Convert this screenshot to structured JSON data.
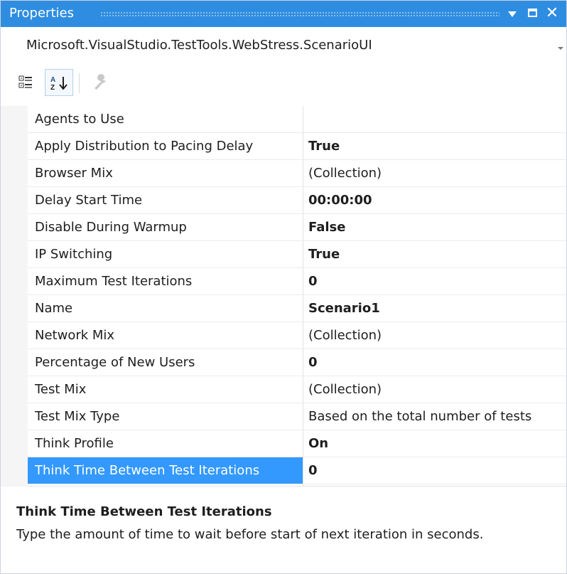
{
  "window": {
    "title": "Properties",
    "accent_color": "#2e8de0",
    "buttons": [
      "dropdown-arrow-icon",
      "maximize-icon",
      "close-icon"
    ],
    "close_label": "✕"
  },
  "object_selector": {
    "value": "Microsoft.VisualStudio.TestTools.WebStress.ScenarioUI"
  },
  "toolbar": {
    "buttons": [
      {
        "name": "categorized",
        "icon": "categorized-icon",
        "active": false
      },
      {
        "name": "alphabetical",
        "icon": "alphabetical-sort-icon",
        "active": true
      },
      {
        "name": "property-pages",
        "icon": "wrench-icon",
        "enabled": false
      }
    ]
  },
  "properties": [
    {
      "name": "Agents to Use",
      "value": "",
      "bold": false
    },
    {
      "name": "Apply Distribution to Pacing Delay",
      "value": "True",
      "bold": true
    },
    {
      "name": "Browser Mix",
      "value": "(Collection)",
      "bold": false
    },
    {
      "name": "Delay Start Time",
      "value": "00:00:00",
      "bold": true
    },
    {
      "name": "Disable During Warmup",
      "value": "False",
      "bold": true
    },
    {
      "name": "IP Switching",
      "value": "True",
      "bold": true
    },
    {
      "name": "Maximum Test Iterations",
      "value": "0",
      "bold": true
    },
    {
      "name": "Name",
      "value": "Scenario1",
      "bold": true
    },
    {
      "name": "Network Mix",
      "value": "(Collection)",
      "bold": false
    },
    {
      "name": "Percentage of New Users",
      "value": "0",
      "bold": true
    },
    {
      "name": "Test Mix",
      "value": "(Collection)",
      "bold": false
    },
    {
      "name": "Test Mix Type",
      "value": "Based on the total number of tests",
      "bold": false
    },
    {
      "name": "Think Profile",
      "value": "On",
      "bold": true
    },
    {
      "name": "Think Time Between Test Iterations",
      "value": "0",
      "bold": true,
      "selected": true
    }
  ],
  "description": {
    "title": "Think Time Between Test Iterations",
    "text": "Type the amount of time to wait before start of next iteration in seconds."
  }
}
